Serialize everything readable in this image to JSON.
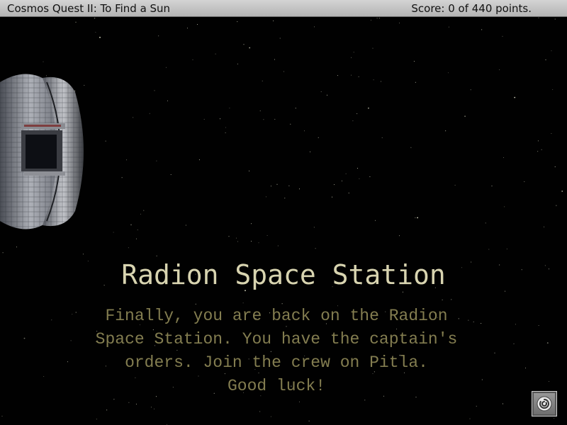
{
  "titlebar": {
    "game_title": "Cosmos Quest II: To Find a Sun",
    "score": "Score: 0 of 440 points."
  },
  "scene": {
    "location_title": "Radion Space Station",
    "narration_lines": [
      "Finally, you are back on the Radion",
      "Space Station. You have the captain's",
      "orders. Join the crew on Pitla.",
      "Good luck!"
    ]
  },
  "controls": {
    "menu_icon": "spiral-menu-icon"
  },
  "colors": {
    "titlebar_bg": "#c4c4c4",
    "title_text": "#d8d4b0",
    "narration_text": "#837d50",
    "space_bg": "#010101"
  }
}
